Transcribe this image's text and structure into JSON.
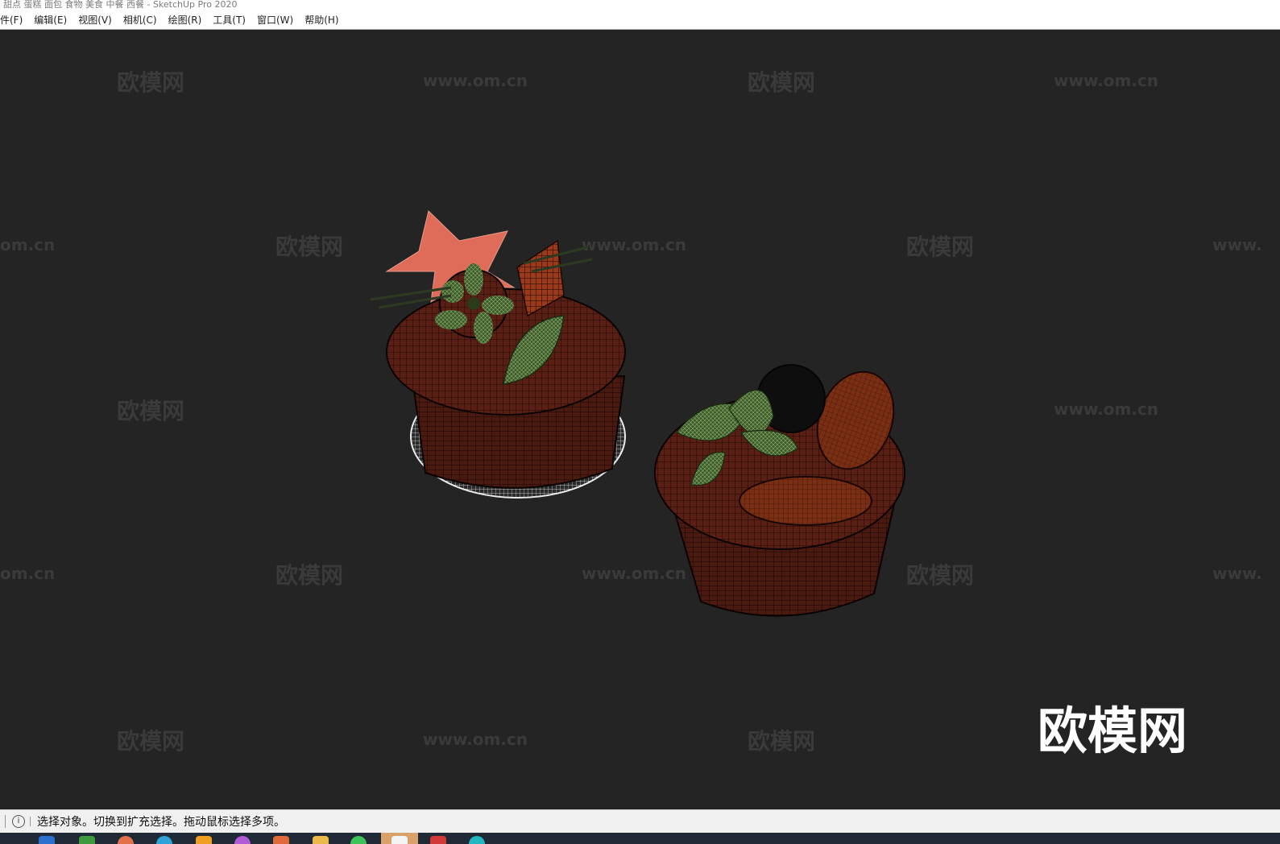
{
  "window": {
    "title": "甜点 蛋糕 面包 食物 美食 中餐 西餐 - SketchUp Pro 2020"
  },
  "menu": [
    {
      "label": "件(F)"
    },
    {
      "label": "编辑(E)"
    },
    {
      "label": "视图(V)"
    },
    {
      "label": "相机(C)"
    },
    {
      "label": "绘图(R)"
    },
    {
      "label": "工具(T)"
    },
    {
      "label": "窗口(W)"
    },
    {
      "label": "帮助(H)"
    }
  ],
  "viewport": {
    "background": "#242424",
    "watermarks": {
      "brand": "欧模网",
      "url": "www.om.cn",
      "url_cut_left": "om.cn",
      "url_cut_right": "www."
    },
    "logo": "欧模网",
    "model": {
      "cake_color": "#5a1f14",
      "leaf_color": "#6f9a3c",
      "star_color": "#e8705c"
    }
  },
  "status": {
    "info_icon": "info-icon",
    "message": "选择对象。切换到扩充选择。拖动鼠标选择多项。"
  },
  "taskbar": {
    "icons": [
      "browser-icon",
      "photos-icon",
      "circle-app-icon",
      "edge-icon",
      "store-icon",
      "color-app-icon",
      "office-icon",
      "folder-icon",
      "chat-icon",
      "sketchup-icon",
      "pdf-icon",
      "globe-icon"
    ]
  }
}
